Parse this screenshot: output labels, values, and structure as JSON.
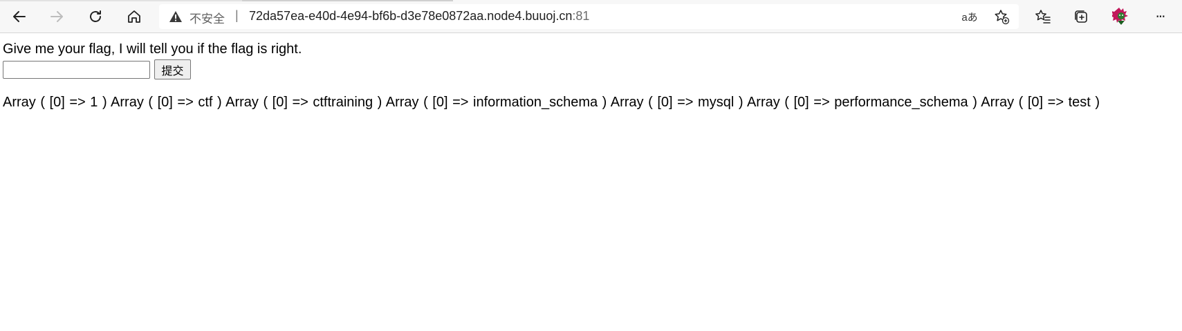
{
  "browser": {
    "address": {
      "security_label": "不安全",
      "separator": "|",
      "url_host": "72da57ea-e40d-4e94-bf6b-d3e78e0872aa.node4.buuoj.cn",
      "url_port": ":81"
    },
    "icons": {
      "back": "back-arrow-icon",
      "forward": "forward-arrow-icon",
      "refresh": "refresh-icon",
      "home": "home-icon",
      "warning": "warning-triangle-icon",
      "read_aloud": "translate-icon",
      "favorite_add": "add-favorite-icon",
      "favorites": "favorites-icon",
      "collections": "collections-icon",
      "profile": "profile-avatar-icon",
      "more": "more-options-icon"
    },
    "translate_glyph": "aあ",
    "more_glyph": "···"
  },
  "page": {
    "prompt": "Give me your flag, I will tell you if the flag is right.",
    "input_value": "",
    "submit_label": "提交",
    "result_text": "Array ( [0] => 1 ) Array ( [0] => ctf ) Array ( [0] => ctftraining ) Array ( [0] => information_schema ) Array ( [0] => mysql ) Array ( [0] => performance_schema ) Array ( [0] => test )"
  }
}
